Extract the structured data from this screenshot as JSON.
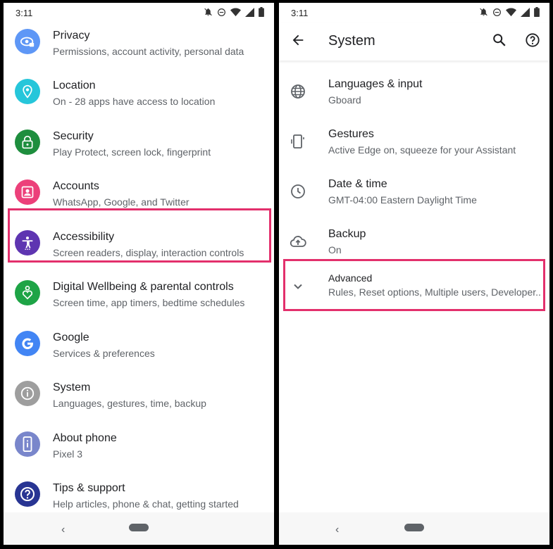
{
  "left": {
    "status_time": "3:11",
    "items": [
      {
        "title": "Privacy",
        "subtitle": "Permissions, account activity, personal data",
        "color": "#5e97f6"
      },
      {
        "title": "Location",
        "subtitle": "On - 28 apps have access to location",
        "color": "#26c6da"
      },
      {
        "title": "Security",
        "subtitle": "Play Protect, screen lock, fingerprint",
        "color": "#1e8e3e"
      },
      {
        "title": "Accounts",
        "subtitle": "WhatsApp, Google, and Twitter",
        "color": "#ec407a"
      },
      {
        "title": "Accessibility",
        "subtitle": "Screen readers, display, interaction controls",
        "color": "#5e35b1"
      },
      {
        "title": "Digital Wellbeing & parental controls",
        "subtitle": "Screen time, app timers, bedtime schedules",
        "color": "#1ea446"
      },
      {
        "title": "Google",
        "subtitle": "Services & preferences",
        "color": "#4285f4"
      },
      {
        "title": "System",
        "subtitle": "Languages, gestures, time, backup",
        "color": "#9e9e9e"
      },
      {
        "title": "About phone",
        "subtitle": "Pixel 3",
        "color": "#7986cb"
      },
      {
        "title": "Tips & support",
        "subtitle": "Help articles, phone & chat, getting started",
        "color": "#283593"
      }
    ]
  },
  "right": {
    "status_time": "3:11",
    "title": "System",
    "items": [
      {
        "title": "Languages & input",
        "subtitle": "Gboard",
        "icon": "globe-icon"
      },
      {
        "title": "Gestures",
        "subtitle": "Active Edge on, squeeze for your Assistant",
        "icon": "gestures-icon"
      },
      {
        "title": "Date & time",
        "subtitle": "GMT-04:00 Eastern Daylight Time",
        "icon": "clock-icon"
      },
      {
        "title": "Backup",
        "subtitle": "On",
        "icon": "cloud-upload-icon"
      },
      {
        "title": "Advanced",
        "subtitle": "Rules, Reset options, Multiple users, Developer..",
        "icon": "chevron-down-icon"
      }
    ]
  },
  "nav": {
    "back_glyph": "‹"
  },
  "highlight_color": "#e3306c"
}
